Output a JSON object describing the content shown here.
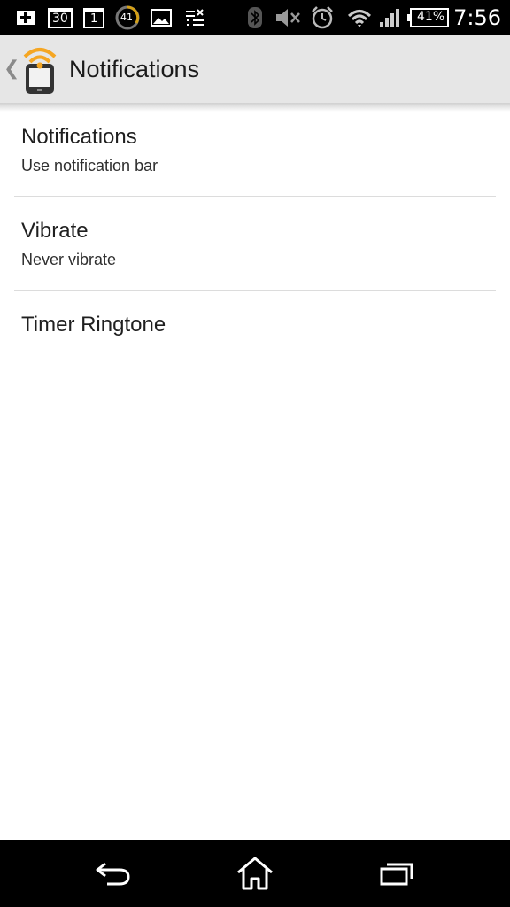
{
  "status_bar": {
    "icons": [
      "add-notification-icon",
      "calendar-30-icon",
      "calendar-1-icon",
      "battery-41-icon",
      "image-icon",
      "task-list-icon",
      "bluetooth-icon",
      "mute-icon",
      "alarm-icon",
      "wifi-icon",
      "signal-icon",
      "battery-icon"
    ],
    "calendar_day_a": "30",
    "calendar_day_b": "1",
    "badge_count": "41",
    "battery_percent": "41%",
    "time": "7:56"
  },
  "action_bar": {
    "title": "Notifications",
    "icon": "phone-wifi-icon",
    "up_icon": "chevron-left-icon"
  },
  "preferences": [
    {
      "title": "Notifications",
      "summary": "Use notification bar"
    },
    {
      "title": "Vibrate",
      "summary": "Never vibrate"
    },
    {
      "title": "Timer Ringtone",
      "summary": ""
    }
  ],
  "nav_bar": {
    "icons": [
      "back-icon",
      "home-icon",
      "recent-apps-icon"
    ]
  },
  "colors": {
    "status_bar": "#000000",
    "action_bar": "#e6e6e6",
    "accent_orange": "#f5a623",
    "divider": "#dcdcdc",
    "background": "#ffffff"
  }
}
